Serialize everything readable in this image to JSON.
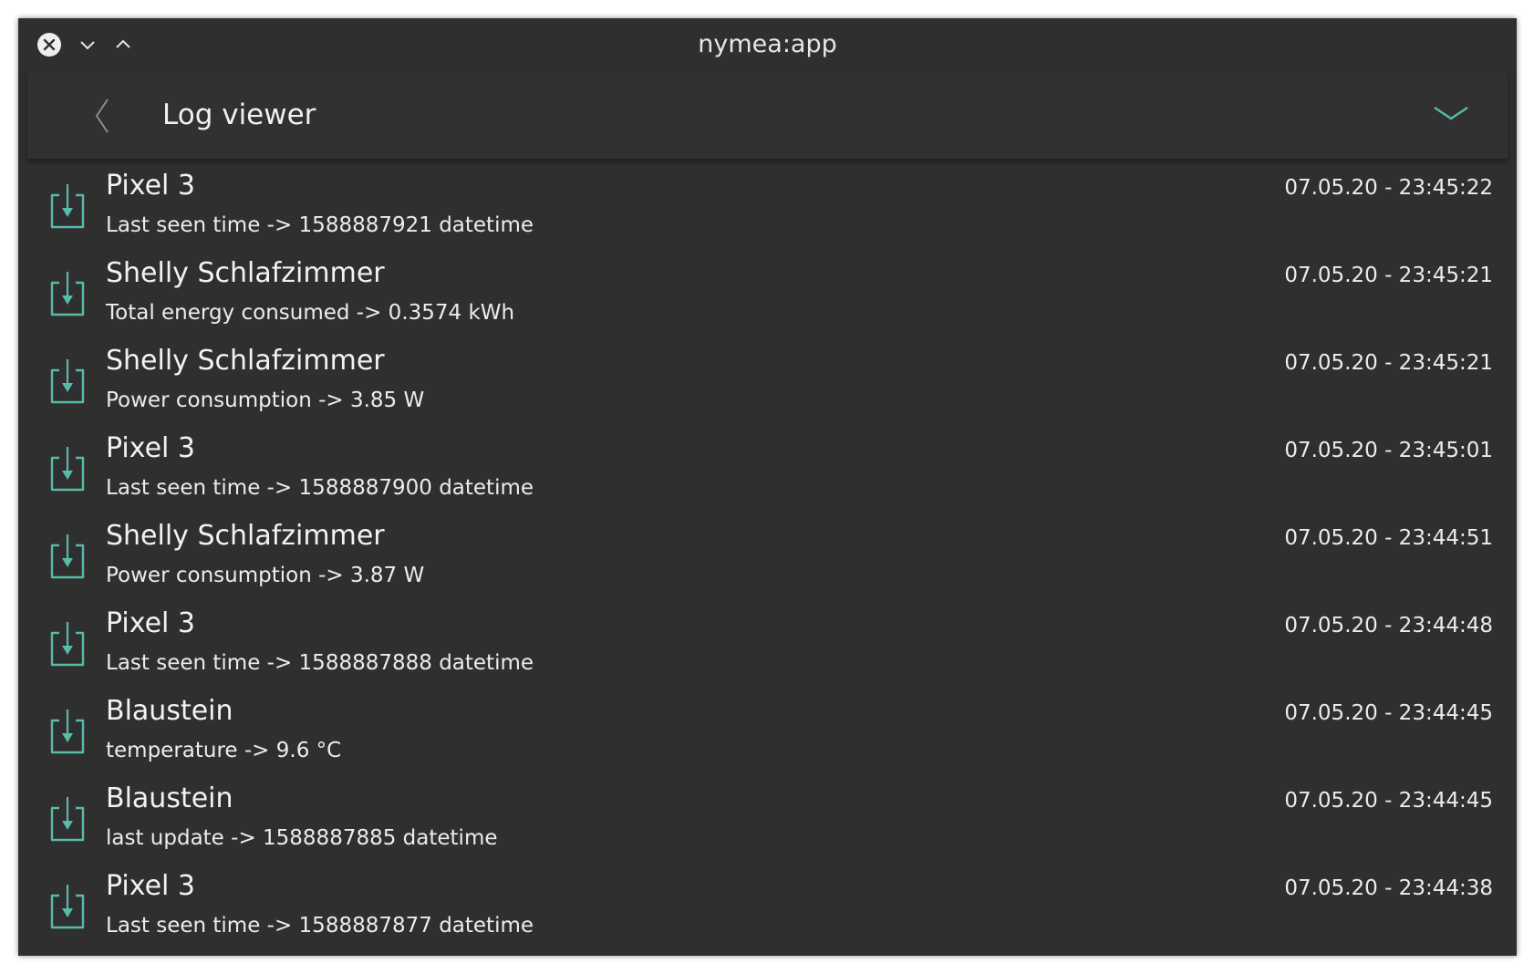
{
  "window": {
    "title": "nymea:app"
  },
  "header": {
    "title": "Log viewer"
  },
  "colors": {
    "accent": "#57bba8",
    "background": "#2f2f2f",
    "header": "#313131",
    "text": "#f0f0f0"
  },
  "icons": {
    "close": "close-icon",
    "minimize": "chevron-down-icon",
    "maximize": "chevron-up-icon",
    "back": "back-chevron-icon",
    "menu": "chevron-down-icon",
    "entry": "download-arrow-icon"
  },
  "log": {
    "entries": [
      {
        "device": "Pixel 3",
        "event": "Last seen time -> 1588887921 datetime",
        "time": "07.05.20 - 23:45:22"
      },
      {
        "device": "Shelly Schlafzimmer",
        "event": "Total energy consumed -> 0.3574 kWh",
        "time": "07.05.20 - 23:45:21"
      },
      {
        "device": "Shelly Schlafzimmer",
        "event": "Power consumption -> 3.85 W",
        "time": "07.05.20 - 23:45:21"
      },
      {
        "device": "Pixel 3",
        "event": "Last seen time -> 1588887900 datetime",
        "time": "07.05.20 - 23:45:01"
      },
      {
        "device": "Shelly Schlafzimmer",
        "event": "Power consumption -> 3.87 W",
        "time": "07.05.20 - 23:44:51"
      },
      {
        "device": "Pixel 3",
        "event": "Last seen time -> 1588887888 datetime",
        "time": "07.05.20 - 23:44:48"
      },
      {
        "device": "Blaustein",
        "event": "temperature -> 9.6 °C",
        "time": "07.05.20 - 23:44:45"
      },
      {
        "device": "Blaustein",
        "event": "last update -> 1588887885 datetime",
        "time": "07.05.20 - 23:44:45"
      },
      {
        "device": "Pixel 3",
        "event": "Last seen time -> 1588887877 datetime",
        "time": "07.05.20 - 23:44:38"
      }
    ]
  }
}
